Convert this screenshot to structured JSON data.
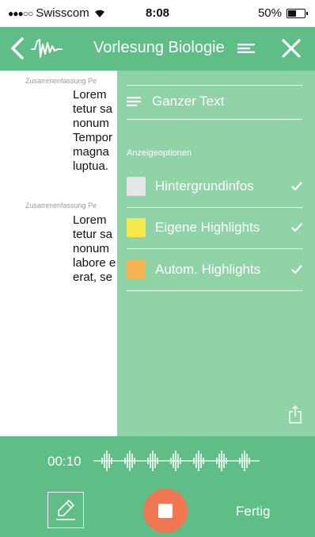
{
  "status_bar": {
    "signal_dots": "●●●○○",
    "carrier": "Swisscom",
    "wifi_icon": "wifi-icon",
    "time": "8:08",
    "battery_text": "50%",
    "battery_level": 0.5
  },
  "nav": {
    "title": "Vorlesung Biologie",
    "back_icon": "chevron-left-icon",
    "logo_icon": "waveform-logo-icon",
    "menu_icon": "lines-icon",
    "close_icon": "close-icon"
  },
  "document": {
    "blocks": [
      {
        "label": "Zusammenfassung Pe",
        "lines": [
          "Lorem",
          "tetur sa",
          "nonum",
          "Tempor",
          "magna",
          "luptua."
        ]
      },
      {
        "label": "Zusammenfassung Pe",
        "lines": [
          "Lorem",
          "tetur sa",
          "nonum",
          "labore e",
          "erat, se"
        ]
      }
    ]
  },
  "panel": {
    "full_text_label": "Ganzer Text",
    "section_label": "Anzeigeoptionen",
    "options": [
      {
        "label": "Hintergrundinfos",
        "color": "#e6e6e6",
        "checked": true
      },
      {
        "label": "Eigene Highlights",
        "color": "#f9e84a",
        "checked": true
      },
      {
        "label": "Autom. Highlights",
        "color": "#f5b24e",
        "checked": true
      }
    ],
    "share_icon": "share-icon"
  },
  "toolbar": {
    "timer": "00:10",
    "done_label": "Fertig",
    "pen_icon": "highlighter-icon",
    "stop_icon": "stop-icon"
  },
  "colors": {
    "brand_green": "#5fbd86",
    "panel_green": "#8fd3a6",
    "record_orange": "#f07752"
  }
}
